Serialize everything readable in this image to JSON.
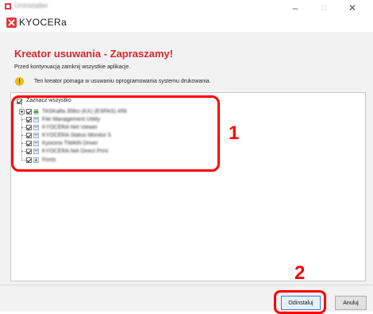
{
  "window": {
    "title": "Uninstaller",
    "controls": {
      "minimize": "–",
      "maximize": "□",
      "close": "✕"
    }
  },
  "logo": {
    "text": "KYOCERa"
  },
  "wizard": {
    "heading": "Kreator usuwania - Zapraszamy!",
    "instruction": "Przed kontynuacją zamknij wszystkie aplikacje.",
    "info": "Ten kreator pomaga w usuwaniu oprogramowania systemu drukowania."
  },
  "tree": {
    "select_all": "Zaznacz wszystko",
    "items": [
      {
        "label": "TASKalfa 356ci (KX) (ESPAS) 456",
        "icon": "printer-icon"
      },
      {
        "label": "File Management Utility",
        "icon": "app-icon"
      },
      {
        "label": "KYOCERA Net Viewer",
        "icon": "app-icon"
      },
      {
        "label": "KYOCERA Status Monitor 5",
        "icon": "app-icon"
      },
      {
        "label": "Kyocera TWAIN Driver",
        "icon": "app-icon"
      },
      {
        "label": "KYOCERA Net Direct Print",
        "icon": "app-icon"
      },
      {
        "label": "Fonts",
        "icon": "font-icon"
      }
    ]
  },
  "callouts": {
    "tree": "1",
    "button": "2"
  },
  "buttons": {
    "uninstall": "Odinstaluj",
    "cancel": "Anuluj"
  },
  "colors": {
    "heading": "#d8282c",
    "callout": "#ff0000",
    "primary_border": "#3c7fd2"
  }
}
